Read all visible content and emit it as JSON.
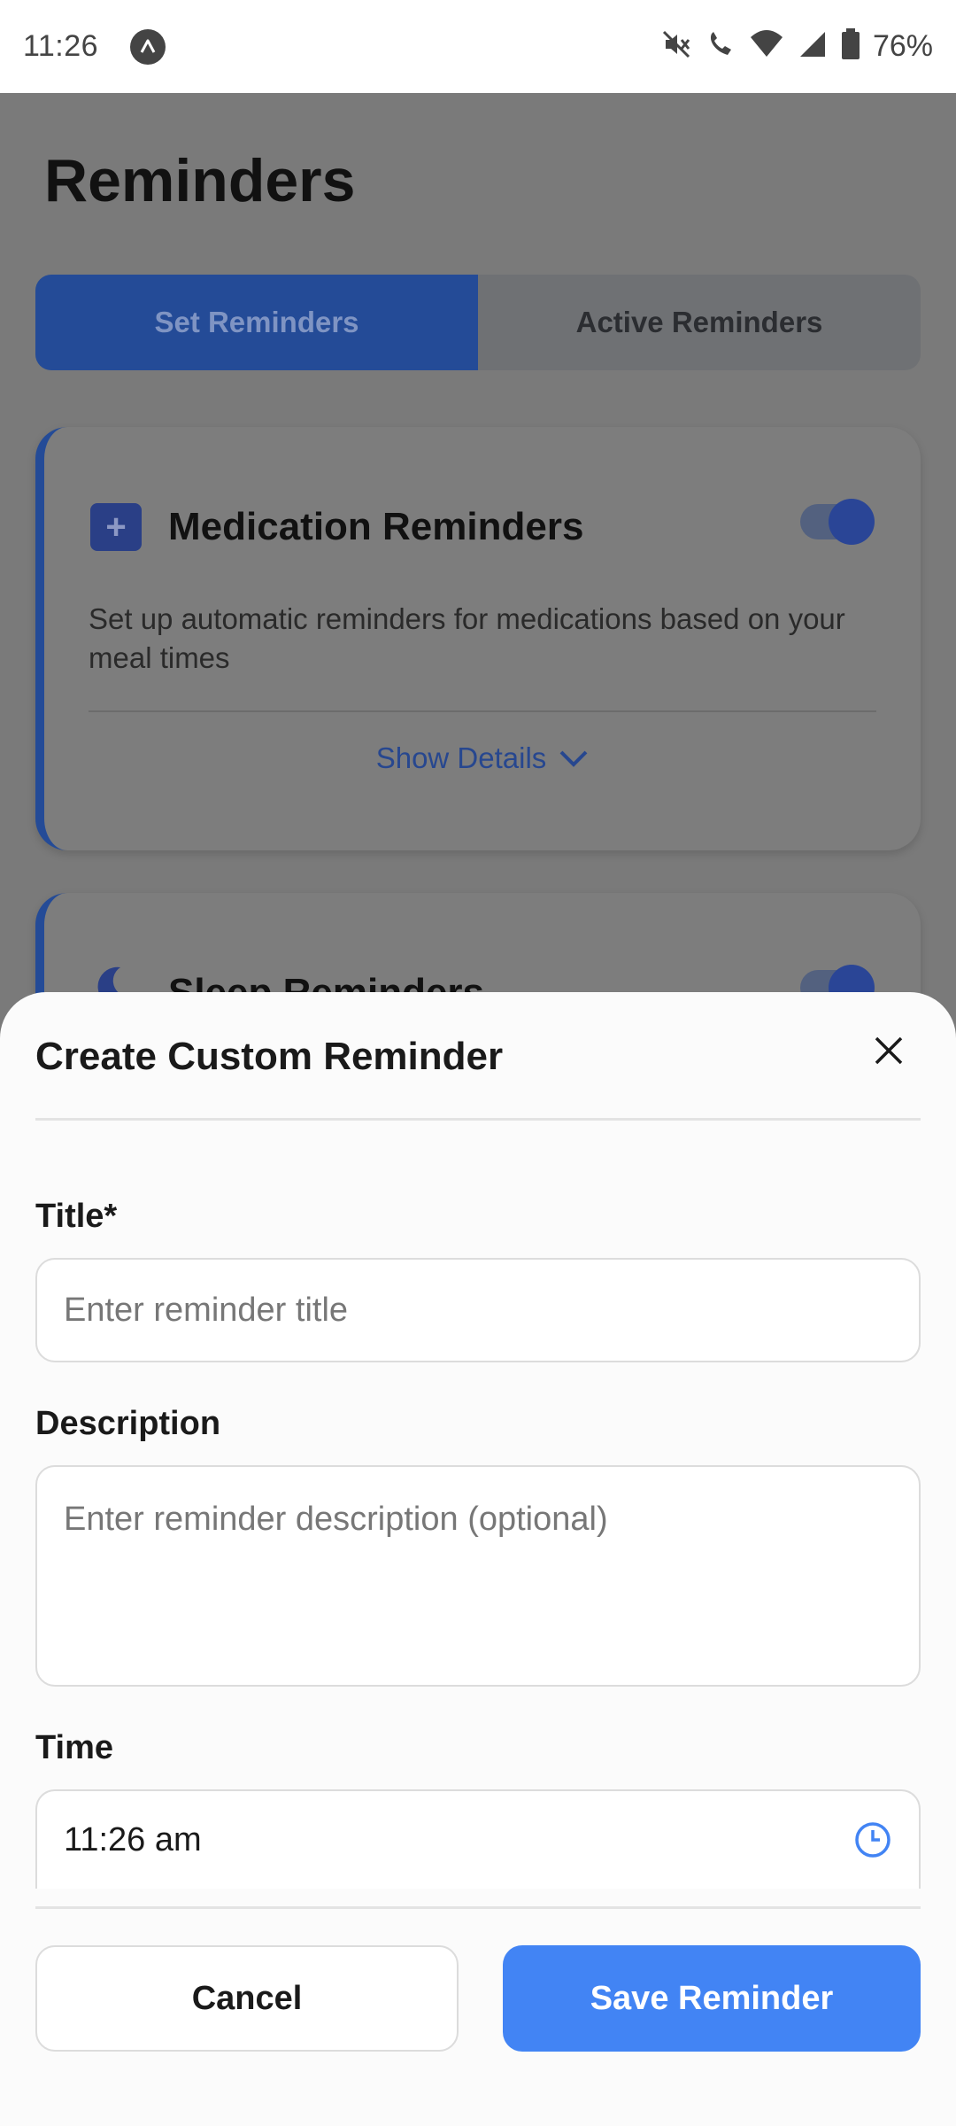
{
  "status_bar": {
    "time": "11:26",
    "battery": "76%"
  },
  "page": {
    "title": "Reminders",
    "tabs": [
      {
        "label": "Set Reminders",
        "active": true
      },
      {
        "label": "Active Reminders",
        "active": false
      }
    ],
    "cards": [
      {
        "icon": "medical-kit-icon",
        "title": "Medication Reminders",
        "description": "Set up automatic reminders for medications based on your meal times",
        "toggle_on": true,
        "show_details": "Show Details"
      },
      {
        "icon": "moon-icon",
        "title": "Sleep Reminders",
        "toggle_on": true
      }
    ]
  },
  "sheet": {
    "title": "Create Custom Reminder",
    "title_label": "Title*",
    "title_placeholder": "Enter reminder title",
    "description_label": "Description",
    "description_placeholder": "Enter reminder description (optional)",
    "time_label": "Time",
    "time_value": "11:26 am",
    "cancel_label": "Cancel",
    "save_label": "Save Reminder"
  },
  "colors": {
    "accent": "#4284f4",
    "tab_active": "#244b97"
  }
}
